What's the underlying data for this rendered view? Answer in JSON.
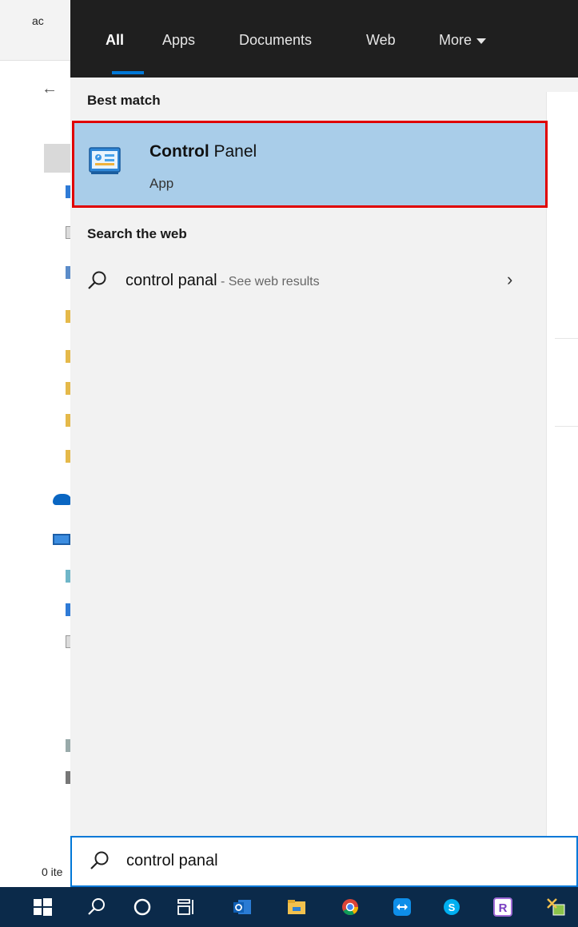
{
  "background_window": {
    "top_text": "ac",
    "status_text": "0 ite"
  },
  "tabs": [
    {
      "label": "All",
      "active": true
    },
    {
      "label": "Apps",
      "active": false
    },
    {
      "label": "Documents",
      "active": false
    },
    {
      "label": "Web",
      "active": false
    },
    {
      "label": "More",
      "active": false
    }
  ],
  "best_match": {
    "section_title": "Best match",
    "title_bold": "Control",
    "title_rest": " Panel",
    "type": "App",
    "icon": "control-panel-icon"
  },
  "web": {
    "section_title": "Search the web",
    "query": "control panal",
    "suffix": " - See web results",
    "icon": "search-icon",
    "chevron": "chevron-right-icon"
  },
  "searchbox": {
    "value": "control panal",
    "icon": "search-icon"
  },
  "taskbar": {
    "icons": [
      "windows-start-icon",
      "search-icon",
      "cortana-icon",
      "task-view-icon",
      "outlook-icon",
      "file-explorer-icon",
      "chrome-icon",
      "teamviewer-icon",
      "skype-icon",
      "rstudio-icon",
      "snipping-tool-icon"
    ]
  },
  "colors": {
    "flyout_bg": "#f2f2f2",
    "topbar_bg": "#1f1f1f",
    "highlight_bg": "#a9cde9",
    "highlight_border": "#e00000",
    "accent": "#0078d7",
    "taskbar_bg": "#0b2a4a"
  }
}
